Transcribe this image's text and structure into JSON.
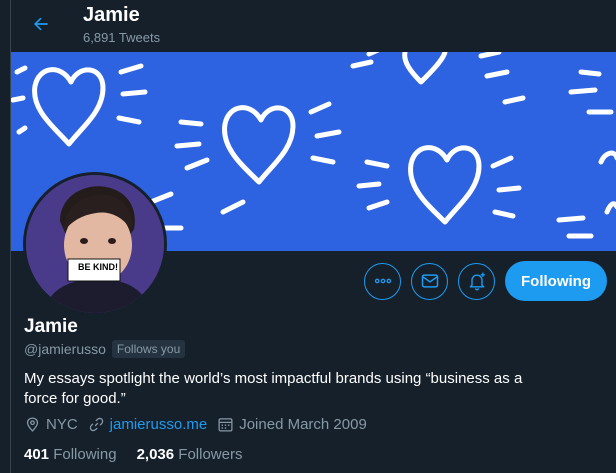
{
  "header": {
    "name": "Jamie",
    "tweet_count": "6,891 Tweets"
  },
  "banner": {
    "background": "#2d63e1",
    "motif": "hand-drawn white hearts"
  },
  "avatar": {
    "sign_text": "BE KIND!"
  },
  "actions": {
    "more_icon": "more-icon",
    "message_icon": "mail-icon",
    "notify_icon": "bell-plus-icon",
    "follow_label": "Following"
  },
  "profile": {
    "name": "Jamie",
    "handle": "@jamierusso",
    "follows_you": "Follows you",
    "bio": "My essays spotlight the world’s most impactful brands using “business as a force for good.”",
    "location": "NYC",
    "website": "jamierusso.me",
    "joined": "Joined March 2009"
  },
  "stats": {
    "following_count": "401",
    "following_label": "Following",
    "followers_count": "2,036",
    "followers_label": "Followers"
  },
  "colors": {
    "background": "#15202b",
    "accent": "#1d9bf0",
    "muted_text": "#8899a6"
  }
}
